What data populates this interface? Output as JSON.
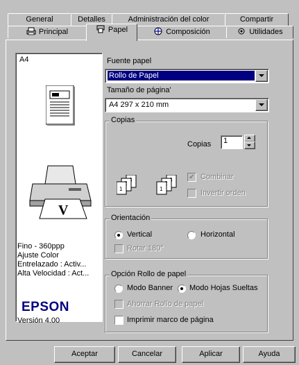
{
  "tabs_back": [
    {
      "label": "General"
    },
    {
      "label": "Detalles"
    },
    {
      "label": "Administración del color"
    },
    {
      "label": "Compartir"
    }
  ],
  "tabs_front": [
    {
      "label": "Principal",
      "icon": "printer-icon"
    },
    {
      "label": "Papel",
      "icon": "paper-icon"
    },
    {
      "label": "Composición",
      "icon": "layout-icon"
    },
    {
      "label": "Utilidades",
      "icon": "tools-icon"
    }
  ],
  "preview": {
    "paper_label": "A4",
    "info_lines": [
      "Fino - 360ppp",
      "Ajuste Color",
      "Entrelazado : Activ...",
      "Alta Velocidad : Act..."
    ],
    "brand": "EPSON",
    "version": "Versión 4.00"
  },
  "paper_source": {
    "label": "Fuente papel",
    "value": "Rollo de Papel"
  },
  "page_size": {
    "label": "Tamaño de página'",
    "value": "A4 297 x 210 mm"
  },
  "copies": {
    "group_label": "Copias",
    "copies_label": "Copias",
    "copies_value": "1",
    "collate_label": "Combinar",
    "collate_checked": "✔",
    "reverse_label": "Invertir orden"
  },
  "orientation": {
    "group_label": "Orientación",
    "vertical_label": "Vertical",
    "horizontal_label": "Horizontal",
    "rotate_label": "Rotar 180°",
    "selected": "vertical"
  },
  "roll_options": {
    "group_label": "Opción Rollo de papel",
    "banner_label": "Modo Banner",
    "sheets_label": "Modo Hojas Sueltas",
    "save_label": "Ahorrar Rollo de papel",
    "frame_label": "Imprimir marco de página",
    "selected": "sheets"
  },
  "buttons": {
    "ok": "Aceptar",
    "cancel": "Cancelar",
    "apply": "Aplicar",
    "help": "Ayuda"
  },
  "colors": {
    "selection": "#000080",
    "face": "#c0c0c0",
    "brand": "#000080"
  }
}
